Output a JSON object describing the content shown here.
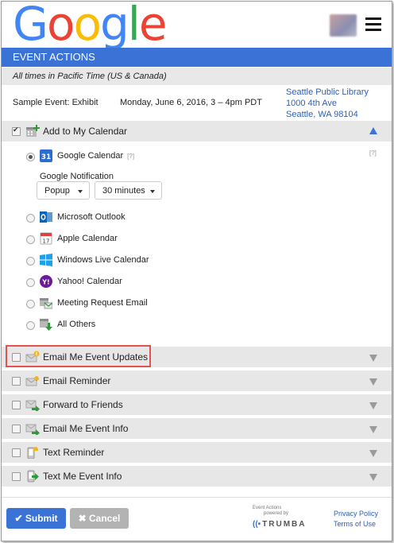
{
  "header": {
    "logo_letters": [
      "G",
      "o",
      "o",
      "g",
      "l",
      "e"
    ],
    "logo_colors": [
      "#4285f4",
      "#ea4335",
      "#fbbc05",
      "#4285f4",
      "#34a853",
      "#ea4335"
    ]
  },
  "banner": {
    "title": "EVENT ACTIONS"
  },
  "timezone": "All times in Pacific Time (US & Canada)",
  "event": {
    "name": "Sample Event: Exhibit",
    "date": "Monday, June 6, 2016, 3 – 4pm PDT",
    "location": [
      "Seattle Public Library",
      "1000 4th Ave",
      "Seattle, WA 98104"
    ]
  },
  "add_calendar": {
    "label": "Add to My Calendar",
    "checked": true,
    "help_right": "[?]",
    "options": [
      {
        "label": "Google Calendar",
        "help": "[?]",
        "selected": true,
        "icon": "google-calendar-icon"
      },
      {
        "label": "Microsoft Outlook",
        "selected": false,
        "icon": "outlook-icon"
      },
      {
        "label": "Apple Calendar",
        "selected": false,
        "icon": "apple-calendar-icon"
      },
      {
        "label": "Windows Live Calendar",
        "selected": false,
        "icon": "windows-icon"
      },
      {
        "label": "Yahoo! Calendar",
        "selected": false,
        "icon": "yahoo-icon"
      },
      {
        "label": "Meeting Request Email",
        "selected": false,
        "icon": "meeting-email-icon"
      },
      {
        "label": "All Others",
        "selected": false,
        "icon": "download-calendar-icon"
      }
    ],
    "google_icon_text": "31",
    "apple_icon_text": "17",
    "yahoo_icon_text": "Y!",
    "notification": {
      "label": "Google Notification",
      "method": "Popup",
      "time": "30 minutes"
    }
  },
  "actions": [
    {
      "label": "Email Me Event Updates",
      "icon": "email-alert-icon",
      "highlighted": true
    },
    {
      "label": "Email Reminder",
      "icon": "email-bell-icon"
    },
    {
      "label": "Forward to Friends",
      "icon": "email-forward-icon"
    },
    {
      "label": "Email Me Event Info",
      "icon": "email-info-icon"
    },
    {
      "label": "Text Reminder",
      "icon": "phone-bell-icon"
    },
    {
      "label": "Text Me Event Info",
      "icon": "phone-info-icon"
    }
  ],
  "footer": {
    "submit": "Submit",
    "cancel": "Cancel",
    "powered_line1": "Event Actions",
    "powered_line2": "powered by",
    "brand": "TRUMBA",
    "privacy": "Privacy Policy",
    "terms": "Terms of Use"
  },
  "colors": {
    "accent": "#3a72d6",
    "link": "#2f5fb3",
    "highlight_border": "#e15252"
  }
}
